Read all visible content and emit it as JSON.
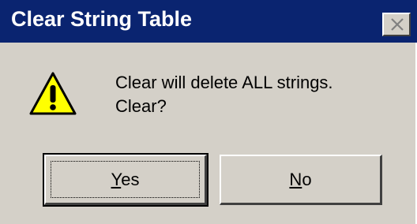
{
  "dialog": {
    "title": "Clear String Table",
    "close_icon": "close-icon",
    "message_icon": "warning-icon",
    "message_line1": "Clear will delete ALL strings.",
    "message_line2": "Clear?",
    "buttons": {
      "yes_mnemonic": "Y",
      "yes_rest": "es",
      "no_mnemonic": "N",
      "no_rest": "o"
    }
  },
  "colors": {
    "titlebar": "#0a2470",
    "dialog_bg": "#d4d0c8",
    "warning_fill": "#ffff00"
  }
}
